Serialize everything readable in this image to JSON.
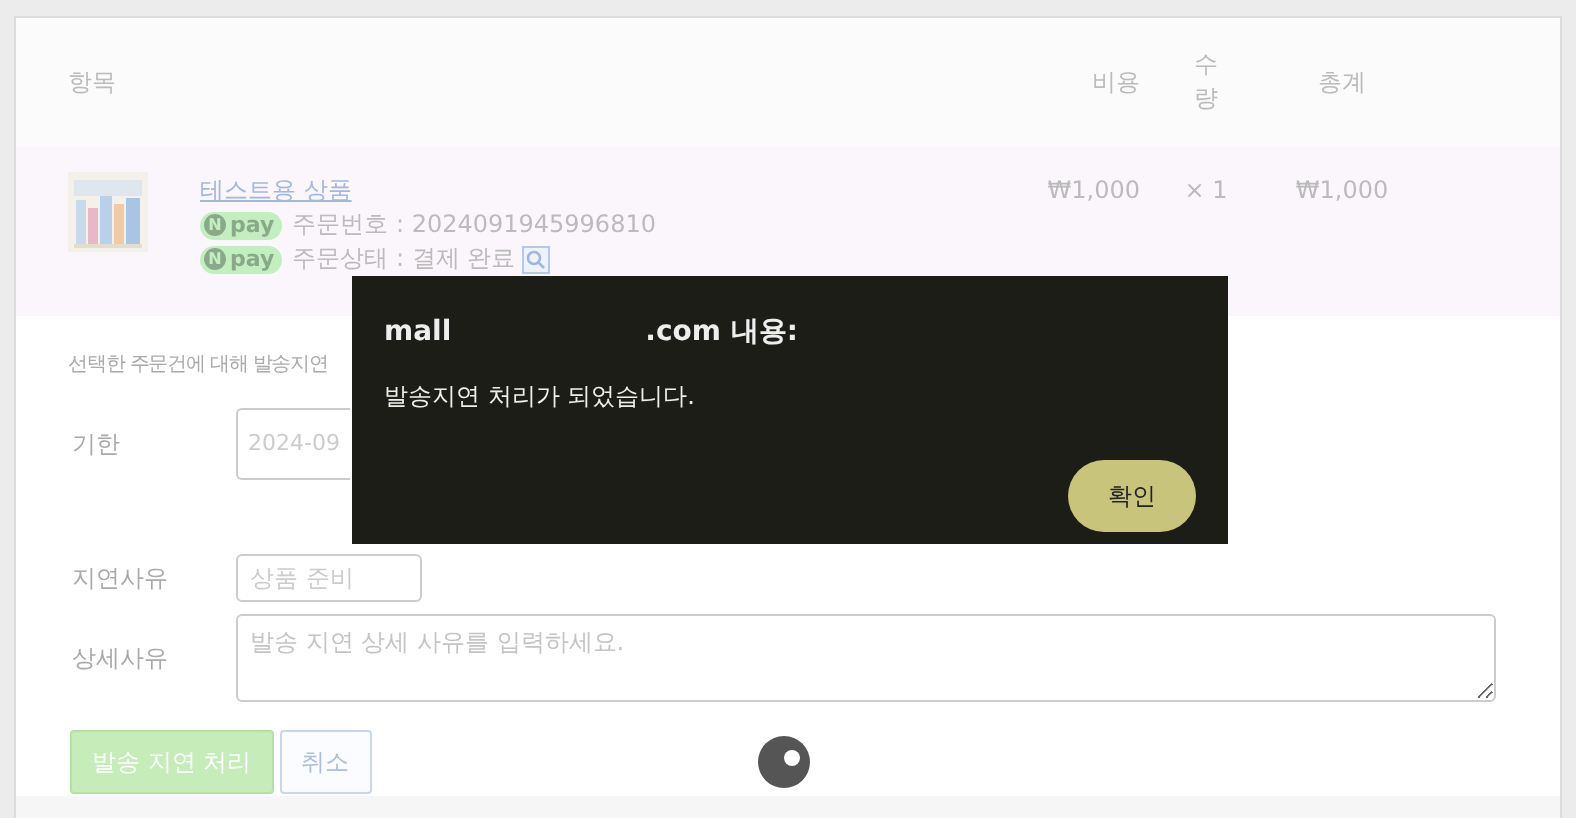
{
  "table": {
    "columns": [
      "항목",
      "비용",
      "수량",
      "총계"
    ],
    "rows": [
      {
        "product": "테스트용 상품",
        "order_no_badge": {
          "mark": "N",
          "label": "pay"
        },
        "order_no": "주문번호 : 2024091945996810",
        "status_badge": {
          "mark": "N",
          "label": "pay"
        },
        "status": "주문상태 : 결제 완료",
        "price": "₩1,000",
        "quantity": "× 1",
        "total": "₩1,000"
      }
    ]
  },
  "delay_form": {
    "intro": "선택한 주문건에 대해 발송지연",
    "fields": [
      {
        "label": "기한",
        "kind": "input",
        "value": "2024-09"
      },
      {
        "label": "지연사유",
        "kind": "select",
        "value": "상품 준비"
      },
      {
        "label": "상세사유",
        "kind": "textarea",
        "placeholder": "발송 지연 상세 사유를 입력하세요."
      }
    ],
    "buttons": [
      {
        "label": "발송 지연 처리",
        "kind": "primary"
      },
      {
        "label": "취소",
        "kind": "secondary"
      }
    ]
  },
  "dialog": {
    "title_start": "mall",
    "title_end": ".com 내용:",
    "message": "발송지연 처리가 되었습니다.",
    "button": "확인"
  }
}
